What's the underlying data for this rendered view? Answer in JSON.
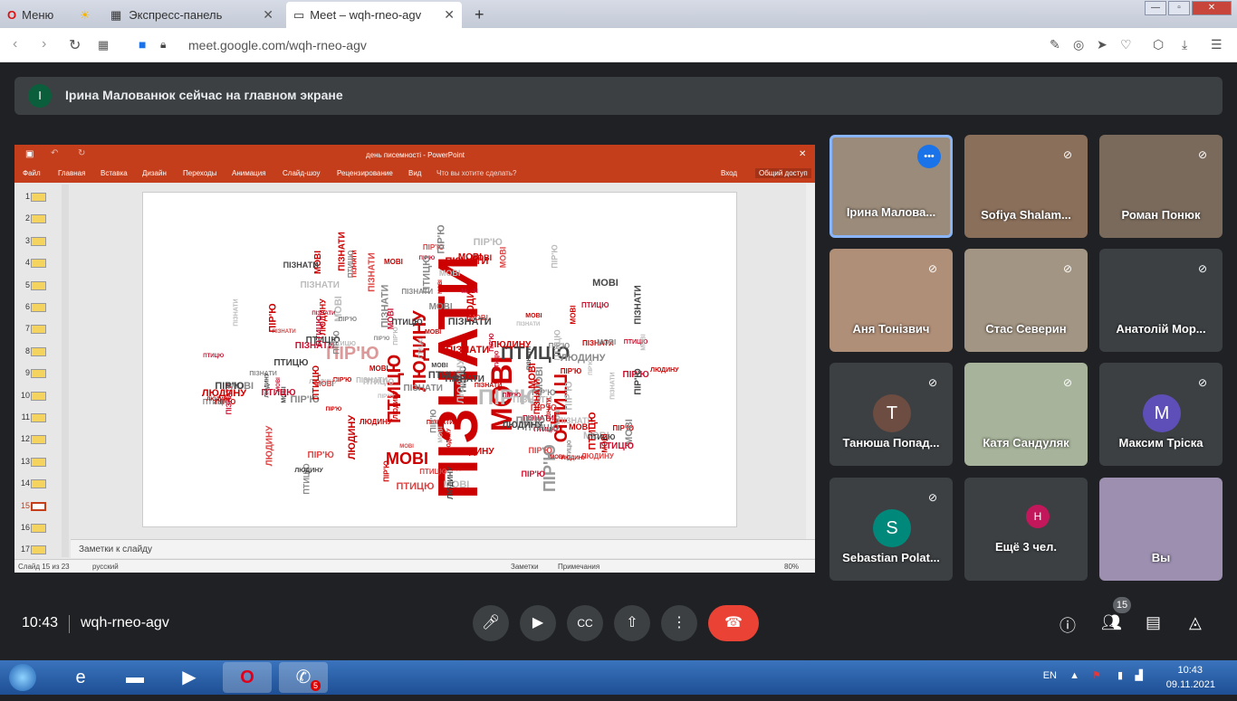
{
  "browser": {
    "tabs": [
      {
        "label": "Меню"
      },
      {
        "label": "Экспресс-панель"
      },
      {
        "label": "Meet – wqh-rneo-agv"
      }
    ],
    "url": "meet.google.com/wqh-rneo-agv"
  },
  "banner": {
    "avatar": "I",
    "text": "Ірина Малованюк сейчас на главном экране"
  },
  "ppt": {
    "title": "день писемності - PowerPoint",
    "menu": [
      "Файл",
      "Главная",
      "Вставка",
      "Дизайн",
      "Переходы",
      "Анимация",
      "Слайд-шоу",
      "Рецензирование",
      "Вид"
    ],
    "tell": "Что вы хотите сделать?",
    "signin": "Вход",
    "share": "Общий доступ",
    "thumbs": [
      "1",
      "2",
      "3",
      "4",
      "5",
      "6",
      "7",
      "8",
      "9",
      "10",
      "11",
      "12",
      "13",
      "14",
      "15",
      "16",
      "17"
    ],
    "selected": 15,
    "notes": "Заметки к слайду",
    "status_slide": "Слайд 15 из 23",
    "status_lang": "русский",
    "status_notes": "Заметки",
    "status_comments": "Примечания",
    "zoom": "80%"
  },
  "slide_words": [
    "ПІЗНАТИ",
    "МОВІ",
    "ПІР'Ю",
    "ЛЮДИНУ",
    "ПТИЦЮ"
  ],
  "tiles": [
    {
      "name": "Ірина Малова...",
      "speaking": true
    },
    {
      "name": "Sofiya Shalam...",
      "muted": true
    },
    {
      "name": "Роман Понюк",
      "muted": true
    },
    {
      "name": "Аня Тонізвич",
      "muted": true
    },
    {
      "name": "Стас Северин",
      "muted": true
    },
    {
      "name": "Анатолій Мор...",
      "muted": true
    },
    {
      "name": "Танюша Попад...",
      "muted": true,
      "letter": "T",
      "color": "#6d4c41"
    },
    {
      "name": "Катя Сандуляк",
      "muted": true
    },
    {
      "name": "Максим Тріска",
      "muted": true,
      "letter": "M",
      "color": "#5e4fb8"
    },
    {
      "name": "Sebastian Polat...",
      "muted": true,
      "letter": "S",
      "color": "#00897b"
    },
    {
      "name": "Ещё 3 чел.",
      "letter": "H"
    },
    {
      "name": "Вы"
    }
  ],
  "meet": {
    "time": "10:43",
    "code": "wqh-rneo-agv",
    "participants": "15"
  },
  "taskbar": {
    "lang": "EN",
    "time": "10:43",
    "date": "09.11.2021",
    "viber_badge": "5"
  },
  "colors": {
    "accent": "#c43e1c",
    "hangup": "#ea4335",
    "meet_bg": "#202124"
  }
}
